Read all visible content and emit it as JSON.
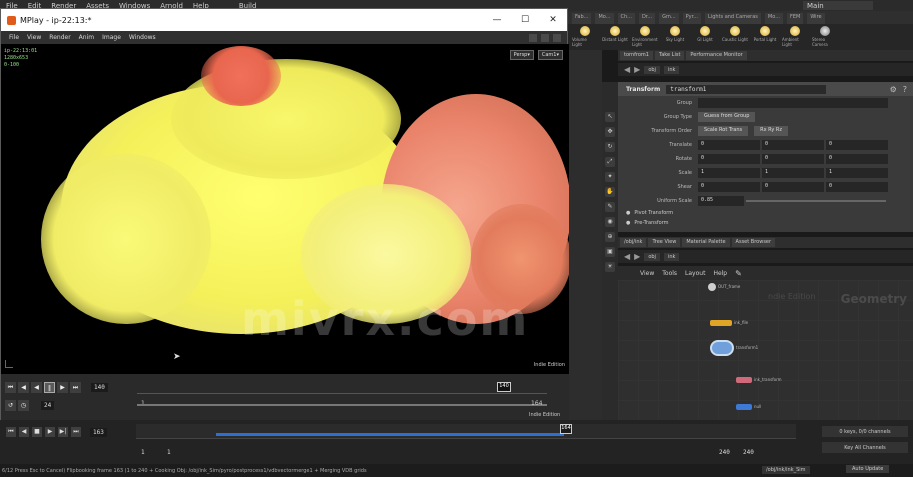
{
  "houdini": {
    "menu": [
      "File",
      "Edit",
      "Render",
      "Assets",
      "Windows",
      "Arnold",
      "Help"
    ],
    "desktop_build": "Build",
    "desktop_main": "Main",
    "main_tab": "Main",
    "shelf_tabs": [
      "Fab...",
      "Mo...",
      "Ch...",
      "Dr...",
      "Gm...",
      "Pyr...",
      "Lights and Cameras",
      "Mo...",
      "FEM",
      "Wire",
      "Crowds",
      "Drive..."
    ],
    "shelf_tools": [
      "Volume Light",
      "Distant Light",
      "Environment Light",
      "Sky Light",
      "GI Light",
      "Caustic Light",
      "Portal Light",
      "Ambient Light",
      "Stereo Camera"
    ],
    "param_tabs": [
      "tornfrom1",
      "Take List",
      "Performance Monitor"
    ],
    "param_path": [
      "obj",
      "ink"
    ],
    "param_node_type": "Transform",
    "param_node_name": "transform1",
    "params": {
      "group_label": "Group",
      "group_type_label": "Group Type",
      "group_type_value": "Guess from Group",
      "xform_order_label": "Transform Order",
      "xform_order_value": "Scale Rot Trans",
      "rot_order_value": "Rx Ry Rz",
      "translate_label": "Translate",
      "translate": [
        "0",
        "0",
        "0"
      ],
      "rotate_label": "Rotate",
      "rotate": [
        "0",
        "0",
        "0"
      ],
      "scale_label": "Scale",
      "scale": [
        "1",
        "1",
        "1"
      ],
      "shear_label": "Shear",
      "shear": [
        "0",
        "0",
        "0"
      ],
      "uniform_scale_label": "Uniform Scale",
      "uniform_scale": "0.85",
      "pivot_label": "Pivot Transform",
      "pretransform_label": "Pre-Transform"
    },
    "net_tabs": [
      "/obj/ink",
      "Tree View",
      "Material Palette",
      "Asset Browser"
    ],
    "net_path": [
      "obj",
      "ink"
    ],
    "net_menu": [
      "View",
      "Tools",
      "Layout",
      "Help"
    ],
    "net_context": "Geometry",
    "net_context_sm": "ndie Edition",
    "net_nodes": [
      {
        "name": "OUT_frame",
        "color": "#cfcfcf"
      },
      {
        "name": "ink_file",
        "color": "#e0a526"
      },
      {
        "name": "transform1",
        "color": "#6fa0dc"
      },
      {
        "name": "ink_transform",
        "color": "#d06a7a"
      },
      {
        "name": "null",
        "color": "#3c7ad6"
      }
    ],
    "playbar": {
      "frame": "163",
      "start": "1",
      "start2": "1",
      "end": "240",
      "end2": "240",
      "marker": "164",
      "keys_label": "0 keys, 0/0 channels",
      "channels_label": "Key All Channels"
    },
    "status": "6/12 Press Esc to Cancel) Flipbooking frame 163 (1 to 240 + Cooking Obj: /obj/ink_Sim/pyro/postprocess1/vdbvectormerge1 + Merging VDB grids",
    "status_path": "/obj/ink/ink_Sim",
    "auto_update": "Auto Update"
  },
  "mplay": {
    "title": "MPlay - ip-22:13:*",
    "win_min": "—",
    "win_max": "☐",
    "win_close": "✕",
    "menu": [
      "File",
      "View",
      "Render",
      "Anim",
      "Image",
      "Windows"
    ],
    "overlay_lines": [
      "ip-22:13:01",
      "1280x653",
      "0-100"
    ],
    "overlay_buttons": [
      "Persp▾",
      "Cam1▾"
    ],
    "edition": "Indie Edition",
    "watermark": "mivrx.com",
    "frame": "140",
    "fps": "24",
    "range_start": "1",
    "range_end": "164",
    "marker": "140",
    "edition2": "Indie Edition"
  }
}
